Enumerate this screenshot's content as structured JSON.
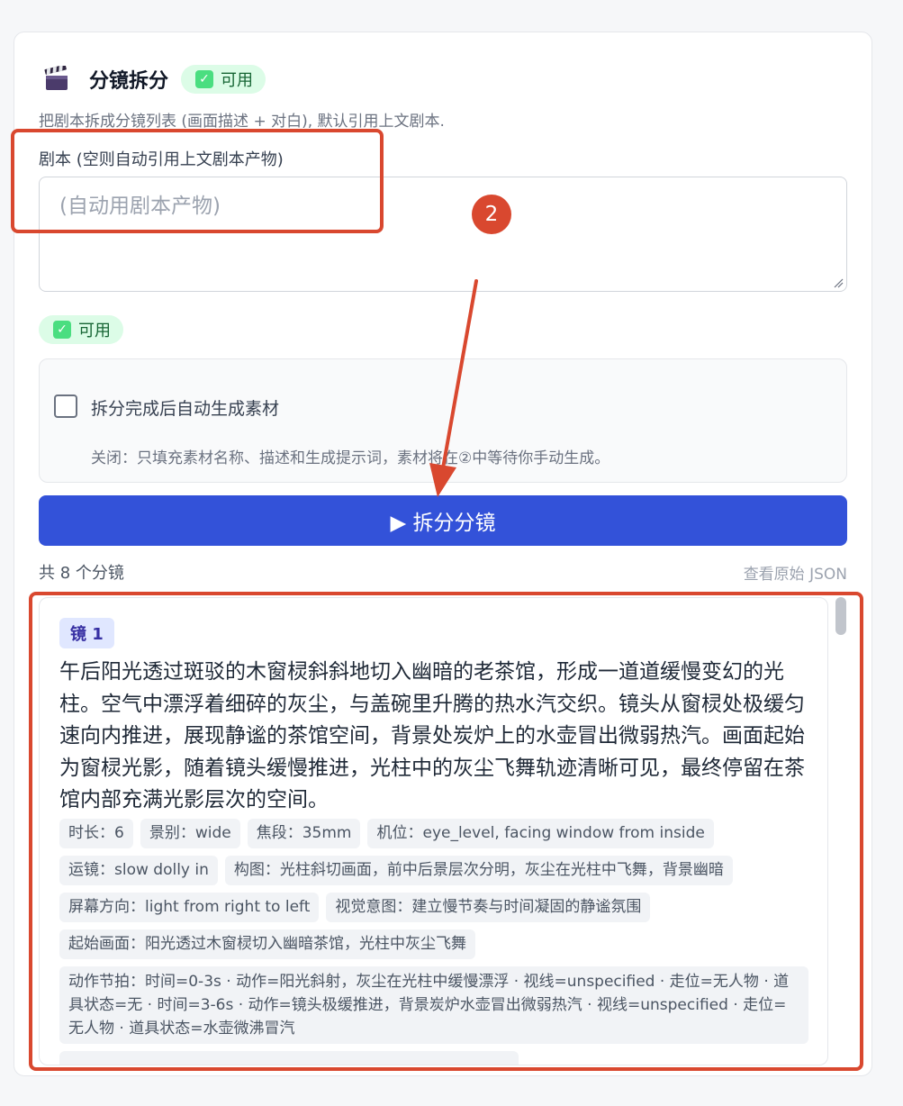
{
  "header": {
    "icon": "clapperboard-icon",
    "title": "分镜拆分",
    "status_badge": "可用"
  },
  "description": "把剧本拆成分镜列表 (画面描述 + 对白), 默认引用上文剧本.",
  "script_field": {
    "label": "剧本 (空则自动引用上文剧本产物)",
    "placeholder": "(自动用剧本产物)",
    "value": ""
  },
  "status_badge_2": "可用",
  "auto_generate": {
    "checked": false,
    "label": "拆分完成后自动生成素材",
    "hint": "关闭：只填充素材名称、描述和生成提示词，素材将在②中等待你手动生成。"
  },
  "split_button": "▶ 拆分分镜",
  "summary": {
    "count": "共 8 个分镜",
    "raw_json_link": "查看原始 JSON"
  },
  "shots": [
    {
      "tag": "镜 1",
      "description": "午后阳光透过斑驳的木窗棂斜斜地切入幽暗的老茶馆，形成一道道缓慢变幻的光柱。空气中漂浮着细碎的灰尘，与盖碗里升腾的热水汽交织。镜头从窗棂处极缓匀速向内推进，展现静谧的茶馆空间，背景处炭炉上的水壶冒出微弱热汽。画面起始为窗棂光影，随着镜头缓慢推进，光柱中的灰尘飞舞轨迹清晰可见，最终停留在茶馆内部充满光影层次的空间。",
      "chips": [
        "时长：6",
        "景别：wide",
        "焦段：35mm",
        "机位：eye_level, facing window from inside",
        "运镜：slow dolly in",
        "构图：光柱斜切画面，前中后景层次分明，灰尘在光柱中飞舞，背景幽暗",
        "屏幕方向：light from right to left",
        "视觉意图：建立慢节奏与时间凝固的静谧氛围",
        "起始画面：阳光透过木窗棂切入幽暗茶馆，光柱中灰尘飞舞",
        "动作节拍：时间=0-3s · 动作=阳光斜射，灰尘在光柱中缓慢漂浮 · 视线=unspecified · 走位=无人物 · 道具状态=无 · 时间=3-6s · 动作=镜头极缓推进，背景炭炉水壶冒出微弱热汽 · 视线=unspecified · 走位=无人物 · 道具状态=水壶微沸冒汽"
      ]
    }
  ],
  "annotation": {
    "step_number": "2",
    "color": "#d9482f"
  },
  "colors": {
    "primary": "#3352d9",
    "badge_bg": "#dcfce7",
    "badge_text": "#166534",
    "shot_tag_bg": "#e0e7ff"
  }
}
